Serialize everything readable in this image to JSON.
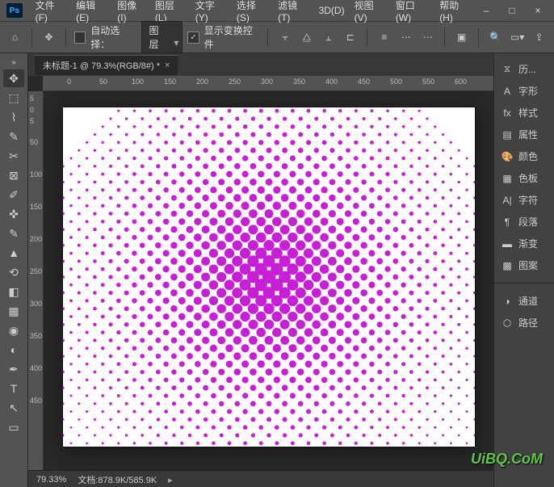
{
  "menu": {
    "file": "文件(F)",
    "edit": "编辑(E)",
    "image": "图像(I)",
    "layer": "图层(L)",
    "type": "文字(Y)",
    "select": "选择(S)",
    "filter": "滤镜(T)",
    "three_d": "3D(D)",
    "view": "视图(V)",
    "window": "窗口(W)",
    "help": "帮助(H)"
  },
  "window_controls": {
    "minimize": "–",
    "maximize": "□",
    "close": "×"
  },
  "options": {
    "auto_select_label": "自动选择：",
    "target_select": "图层",
    "show_transform": "显示变换控件"
  },
  "tab": {
    "title": "未标题-1 @ 79.3%(RGB/8#) *"
  },
  "ruler": {
    "h": [
      "0",
      "50",
      "100",
      "150",
      "200",
      "250",
      "300",
      "350",
      "400",
      "450",
      "500",
      "550",
      "600"
    ],
    "v": [
      "5",
      "0",
      "5",
      "50",
      "100",
      "150",
      "200",
      "250",
      "300",
      "350",
      "400",
      "450"
    ]
  },
  "status": {
    "zoom": "79.33%",
    "doc": "文档:878.9K/585.9K"
  },
  "right_panels": {
    "history": "历...",
    "glyphs": "字形",
    "styles": "样式",
    "properties": "属性",
    "color": "颜色",
    "swatches": "色板",
    "character": "字符",
    "paragraph": "段落",
    "gradient": "渐变",
    "patterns": "图案",
    "channels": "通道",
    "paths": "路径"
  },
  "watermark": "UiBQ.CoM",
  "icons": {
    "ps": "Ps"
  },
  "chart_data": null
}
